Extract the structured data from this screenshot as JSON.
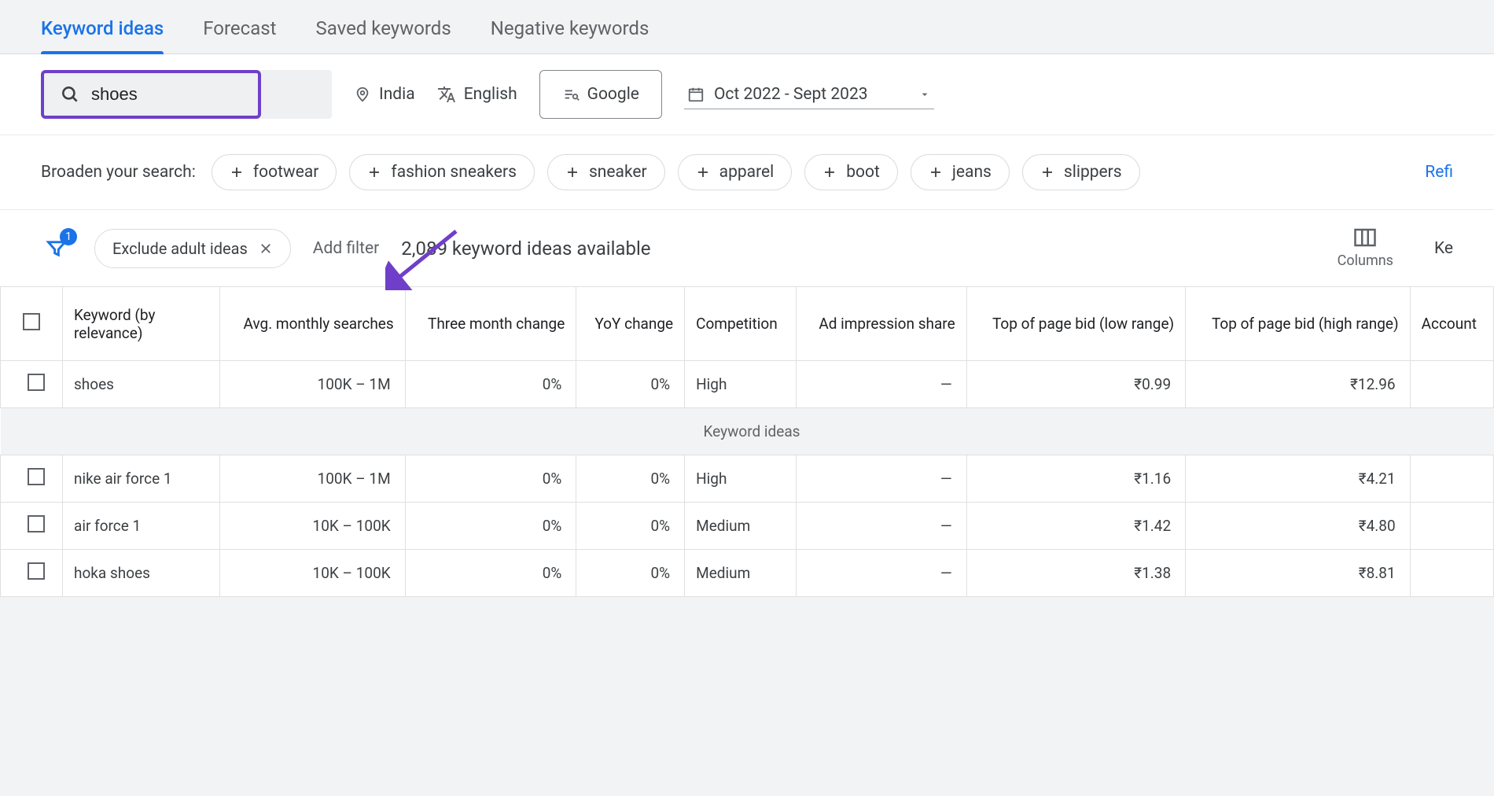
{
  "tabs": {
    "ideas": "Keyword ideas",
    "forecast": "Forecast",
    "saved": "Saved keywords",
    "negative": "Negative keywords"
  },
  "toolbar": {
    "search_value": "shoes",
    "location": "India",
    "language": "English",
    "network": "Google",
    "date_range": "Oct 2022 - Sept 2023"
  },
  "broaden": {
    "label": "Broaden your search:",
    "chips": [
      "footwear",
      "fashion sneakers",
      "sneaker",
      "apparel",
      "boot",
      "jeans",
      "slippers"
    ],
    "refine": "Refi"
  },
  "filters": {
    "funnel_badge": "1",
    "exclude_chip": "Exclude adult ideas",
    "add_filter": "Add filter",
    "ideas_available": "2,089 keyword ideas available",
    "columns_label": "Columns",
    "key_cut": "Ke"
  },
  "headers": {
    "keyword": "Keyword (by relevance)",
    "avg": "Avg. monthly searches",
    "three_mo": "Three month change",
    "yoy": "YoY change",
    "competition": "Competition",
    "ad_share": "Ad impression share",
    "bid_low": "Top of page bid (low range)",
    "bid_high": "Top of page bid (high range)",
    "account": "Account "
  },
  "section_label": "Keyword ideas",
  "rows_top": [
    {
      "keyword": "shoes",
      "avg": "100K – 1M",
      "three_mo": "0%",
      "yoy": "0%",
      "competition": "High",
      "ad_share": "—",
      "bid_low": "₹0.99",
      "bid_high": "₹12.96"
    }
  ],
  "rows_ideas": [
    {
      "keyword": "nike air force 1",
      "avg": "100K – 1M",
      "three_mo": "0%",
      "yoy": "0%",
      "competition": "High",
      "ad_share": "—",
      "bid_low": "₹1.16",
      "bid_high": "₹4.21"
    },
    {
      "keyword": "air force 1",
      "avg": "10K – 100K",
      "three_mo": "0%",
      "yoy": "0%",
      "competition": "Medium",
      "ad_share": "—",
      "bid_low": "₹1.42",
      "bid_high": "₹4.80"
    },
    {
      "keyword": "hoka shoes",
      "avg": "10K – 100K",
      "three_mo": "0%",
      "yoy": "0%",
      "competition": "Medium",
      "ad_share": "—",
      "bid_low": "₹1.38",
      "bid_high": "₹8.81"
    }
  ]
}
